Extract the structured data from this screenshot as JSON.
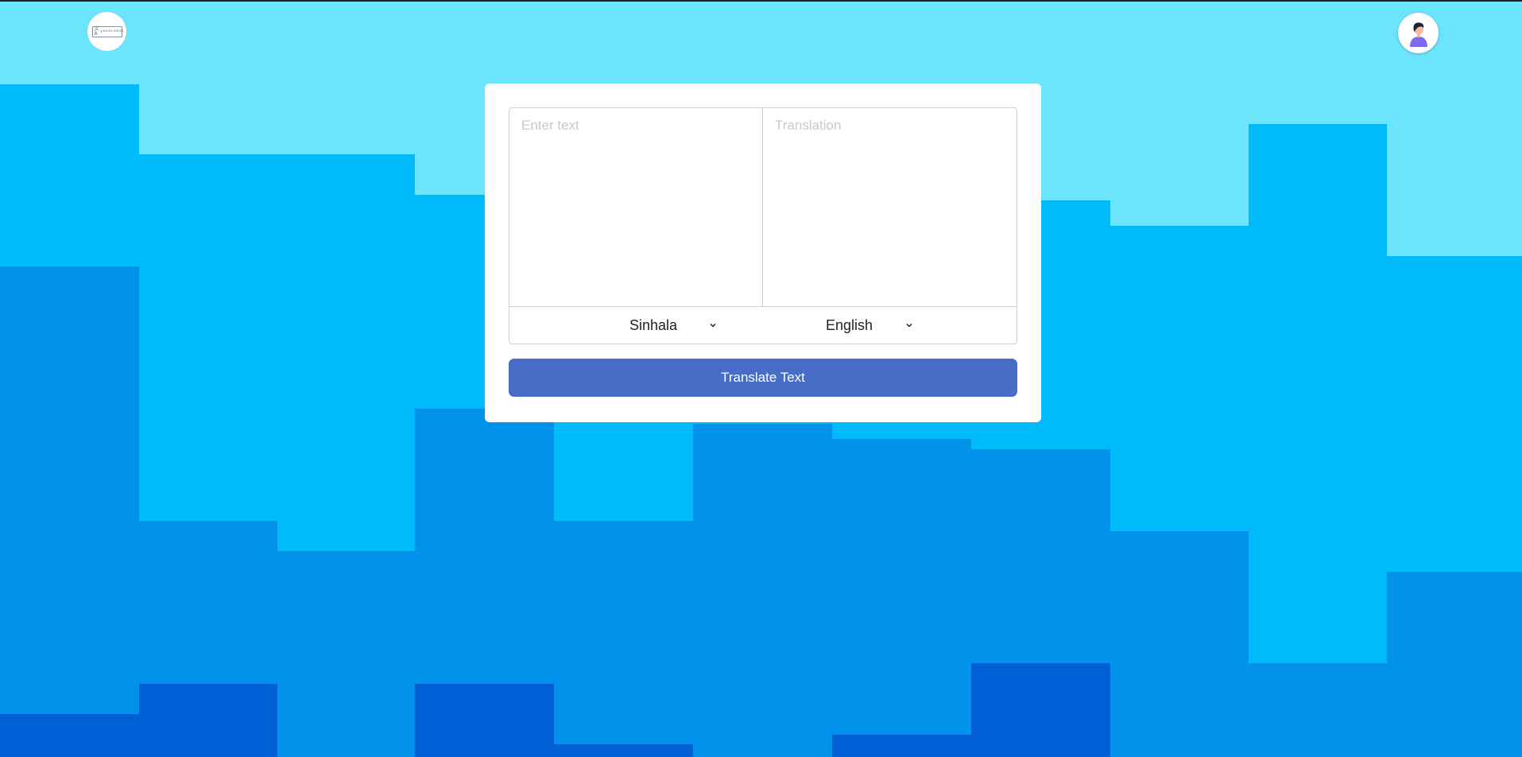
{
  "header": {
    "logo_icon": "translate-logo-icon",
    "logo_glyph": "文A",
    "logo_text": "BOGGS WORDS",
    "avatar_icon": "user-avatar-icon"
  },
  "translator": {
    "source_placeholder": "Enter text",
    "target_placeholder": "Translation",
    "source_language": "Sinhala",
    "target_language": "English",
    "translate_button": "Translate Text"
  },
  "colors": {
    "sky_light": "#6ce4fb",
    "band_cyan": "#00bbf9",
    "band_blue": "#0193eb",
    "band_deep": "#015fd6",
    "button": "#486dc7"
  }
}
